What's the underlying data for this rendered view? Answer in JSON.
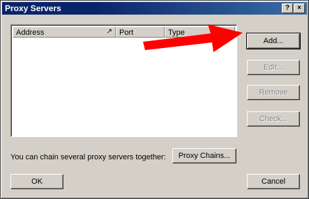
{
  "window": {
    "title": "Proxy Servers",
    "help_button": "?",
    "close_button": "×"
  },
  "list": {
    "columns": [
      "Address",
      "Port",
      "Type"
    ],
    "sort_indicator": "↗",
    "rows": []
  },
  "buttons": {
    "add": "Add...",
    "edit": "Edit...",
    "remove": "Remove",
    "check": "Check...",
    "proxy_chains": "Proxy Chains...",
    "ok": "OK",
    "cancel": "Cancel"
  },
  "chain_label": "You can chain several proxy servers together:",
  "annotation": {
    "arrow_color": "#ff0000"
  }
}
